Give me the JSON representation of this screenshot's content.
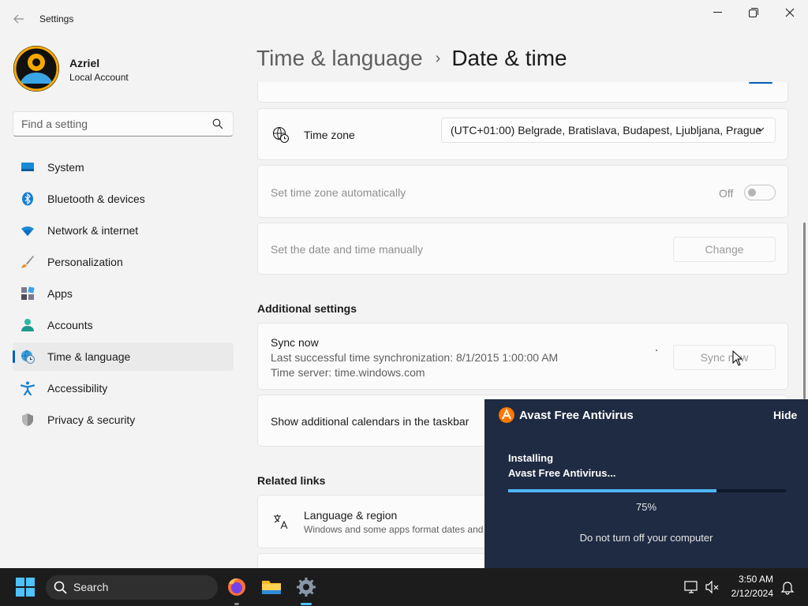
{
  "window": {
    "title": "Settings",
    "minimize_label": "Minimize",
    "maximize_label": "Maximize",
    "close_label": "Close"
  },
  "profile": {
    "name": "Azriel",
    "account_type": "Local Account"
  },
  "search": {
    "placeholder": "Find a setting"
  },
  "sidebar": {
    "items": [
      {
        "label": "System",
        "icon": "monitor-icon"
      },
      {
        "label": "Bluetooth & devices",
        "icon": "bluetooth-icon"
      },
      {
        "label": "Network & internet",
        "icon": "wifi-icon"
      },
      {
        "label": "Personalization",
        "icon": "brush-icon"
      },
      {
        "label": "Apps",
        "icon": "apps-icon"
      },
      {
        "label": "Accounts",
        "icon": "person-icon"
      },
      {
        "label": "Time & language",
        "icon": "globe-clock-icon",
        "active": true
      },
      {
        "label": "Accessibility",
        "icon": "accessibility-icon"
      },
      {
        "label": "Privacy & security",
        "icon": "shield-icon"
      }
    ]
  },
  "header": {
    "parent": "Time & language",
    "separator": "›",
    "current": "Date & time"
  },
  "settings": {
    "time_zone": {
      "label": "Time zone",
      "value": "(UTC+01:00) Belgrade, Bratislava, Budapest, Ljubljana, Prague"
    },
    "auto_time_zone": {
      "label": "Set time zone automatically",
      "toggle_state": "Off"
    },
    "manual_date_time": {
      "label": "Set the date and time manually",
      "button": "Change"
    }
  },
  "additional": {
    "section_title": "Additional settings",
    "sync": {
      "title": "Sync now",
      "last_sync": "Last successful time synchronization: 8/1/2015 1:00:00 AM",
      "server": "Time server: time.windows.com",
      "button": "Sync now"
    },
    "calendars": {
      "label": "Show additional calendars in the taskbar"
    }
  },
  "related": {
    "section_title": "Related links",
    "language_region": {
      "title": "Language & region",
      "subtitle": "Windows and some apps format dates and"
    }
  },
  "avast": {
    "title": "Avast Free Antivirus",
    "hide": "Hide",
    "status_line1": "Installing",
    "status_line2": "Avast Free Antivirus...",
    "progress": 75,
    "progress_text": "75%",
    "warning": "Do not turn off your computer",
    "brand_color": "#ff7800",
    "background": "#1f2b43"
  },
  "taskbar": {
    "search_label": "Search",
    "apps": [
      "firefox-icon",
      "file-explorer-icon",
      "settings-icon"
    ],
    "time": "3:50 AM",
    "date": "2/12/2024"
  },
  "colors": {
    "accent": "#005fb8"
  }
}
